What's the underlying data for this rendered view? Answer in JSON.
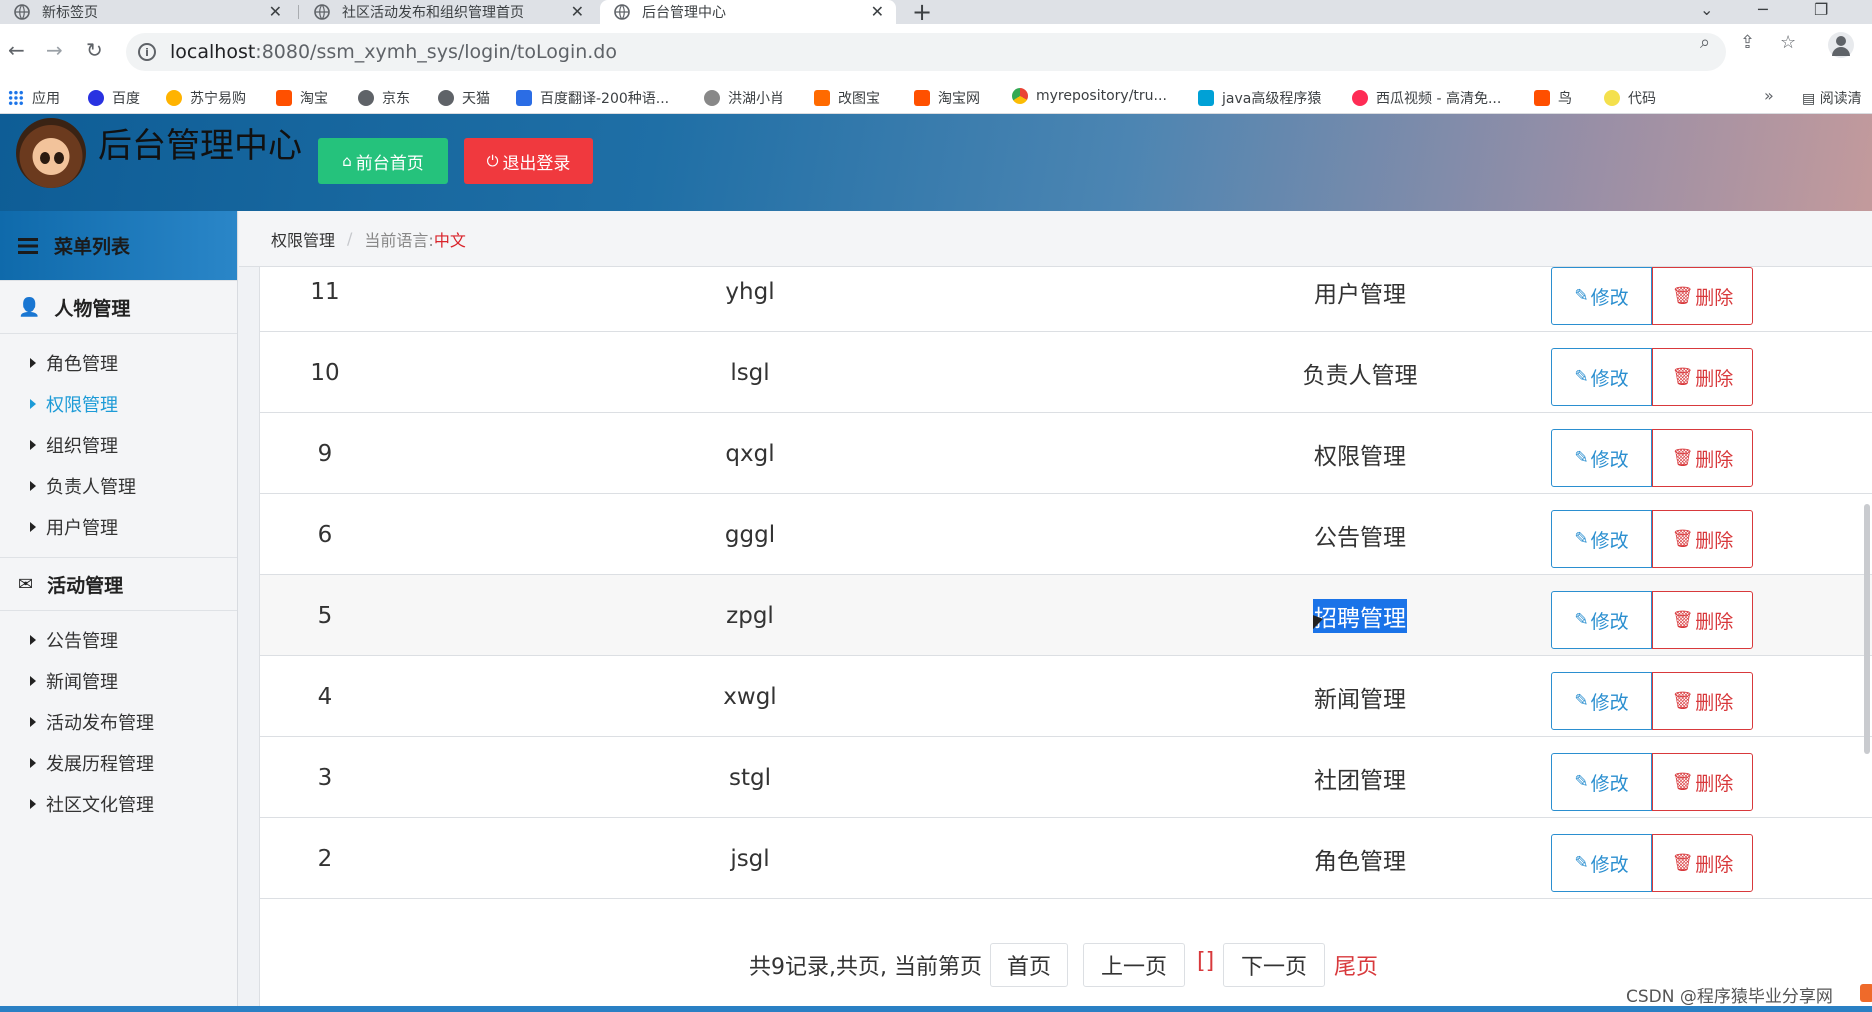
{
  "browser": {
    "tabs": [
      {
        "title": "新标签页",
        "active": false
      },
      {
        "title": "社区活动发布和组织管理首页",
        "active": false
      },
      {
        "title": "后台管理中心",
        "active": true
      }
    ],
    "new_tab_symbol": "+",
    "url_host": "localhost",
    "url_rest": ":8080/ssm_xymh_sys/login/toLogin.do",
    "bookmarks": [
      {
        "label": "应用",
        "color": "#1a73e8"
      },
      {
        "label": "百度",
        "color": "#2932e1"
      },
      {
        "label": "苏宁易购",
        "color": "#ffb300"
      },
      {
        "label": "淘宝",
        "color": "#ff5000"
      },
      {
        "label": "京东",
        "color": "#5f6368"
      },
      {
        "label": "天猫",
        "color": "#5f6368"
      },
      {
        "label": "百度翻译-200种语...",
        "color": "#2b6de5"
      },
      {
        "label": "洪湖小肖",
        "color": "#888888"
      },
      {
        "label": "改图宝",
        "color": "#ff6a00"
      },
      {
        "label": "淘宝网",
        "color": "#ff5000"
      },
      {
        "label": "myrepository/tru...",
        "color": "#34a853"
      },
      {
        "label": "java高级程序猿",
        "color": "#00a1d6"
      },
      {
        "label": "西瓜视频 - 高清免...",
        "color": "#fe2c55"
      },
      {
        "label": "鸟",
        "color": "#ff4f00"
      },
      {
        "label": "代码",
        "color": "#f4e04d"
      }
    ],
    "bookmarks_more": "»",
    "reading_list": "阅读清"
  },
  "header": {
    "title": "后台管理中心",
    "home_button": "前台首页",
    "logout_button": "退出登录"
  },
  "sidebar": {
    "menu_title": "菜单列表",
    "groups": [
      {
        "title": "人物管理",
        "items": [
          "角色管理",
          "权限管理",
          "组织管理",
          "负责人管理",
          "用户管理"
        ]
      },
      {
        "title": "活动管理",
        "items": [
          "公告管理",
          "新闻管理",
          "活动发布管理",
          "发展历程管理",
          "社区文化管理"
        ]
      }
    ],
    "active_item": "权限管理"
  },
  "breadcrumb": {
    "current": "权限管理",
    "lang_label": "当前语言:",
    "lang_value": "中文"
  },
  "table": {
    "edit_label": "修改",
    "delete_label": "删除",
    "rows": [
      {
        "id": "11",
        "code": "yhgl",
        "name": "用户管理"
      },
      {
        "id": "10",
        "code": "lsgl",
        "name": "负责人管理"
      },
      {
        "id": "9",
        "code": "qxgl",
        "name": "权限管理"
      },
      {
        "id": "6",
        "code": "gggl",
        "name": "公告管理"
      },
      {
        "id": "5",
        "code": "zpgl",
        "name": "招聘管理"
      },
      {
        "id": "4",
        "code": "xwgl",
        "name": "新闻管理"
      },
      {
        "id": "3",
        "code": "stgl",
        "name": "社团管理"
      },
      {
        "id": "2",
        "code": "jsgl",
        "name": "角色管理"
      }
    ]
  },
  "pager": {
    "summary": "共9记录,共页, 当前第页",
    "first": "首页",
    "prev": "上一页",
    "current": "[]",
    "next": "下一页",
    "last": "尾页"
  },
  "watermark": "CSDN @程序猿毕业分享网"
}
